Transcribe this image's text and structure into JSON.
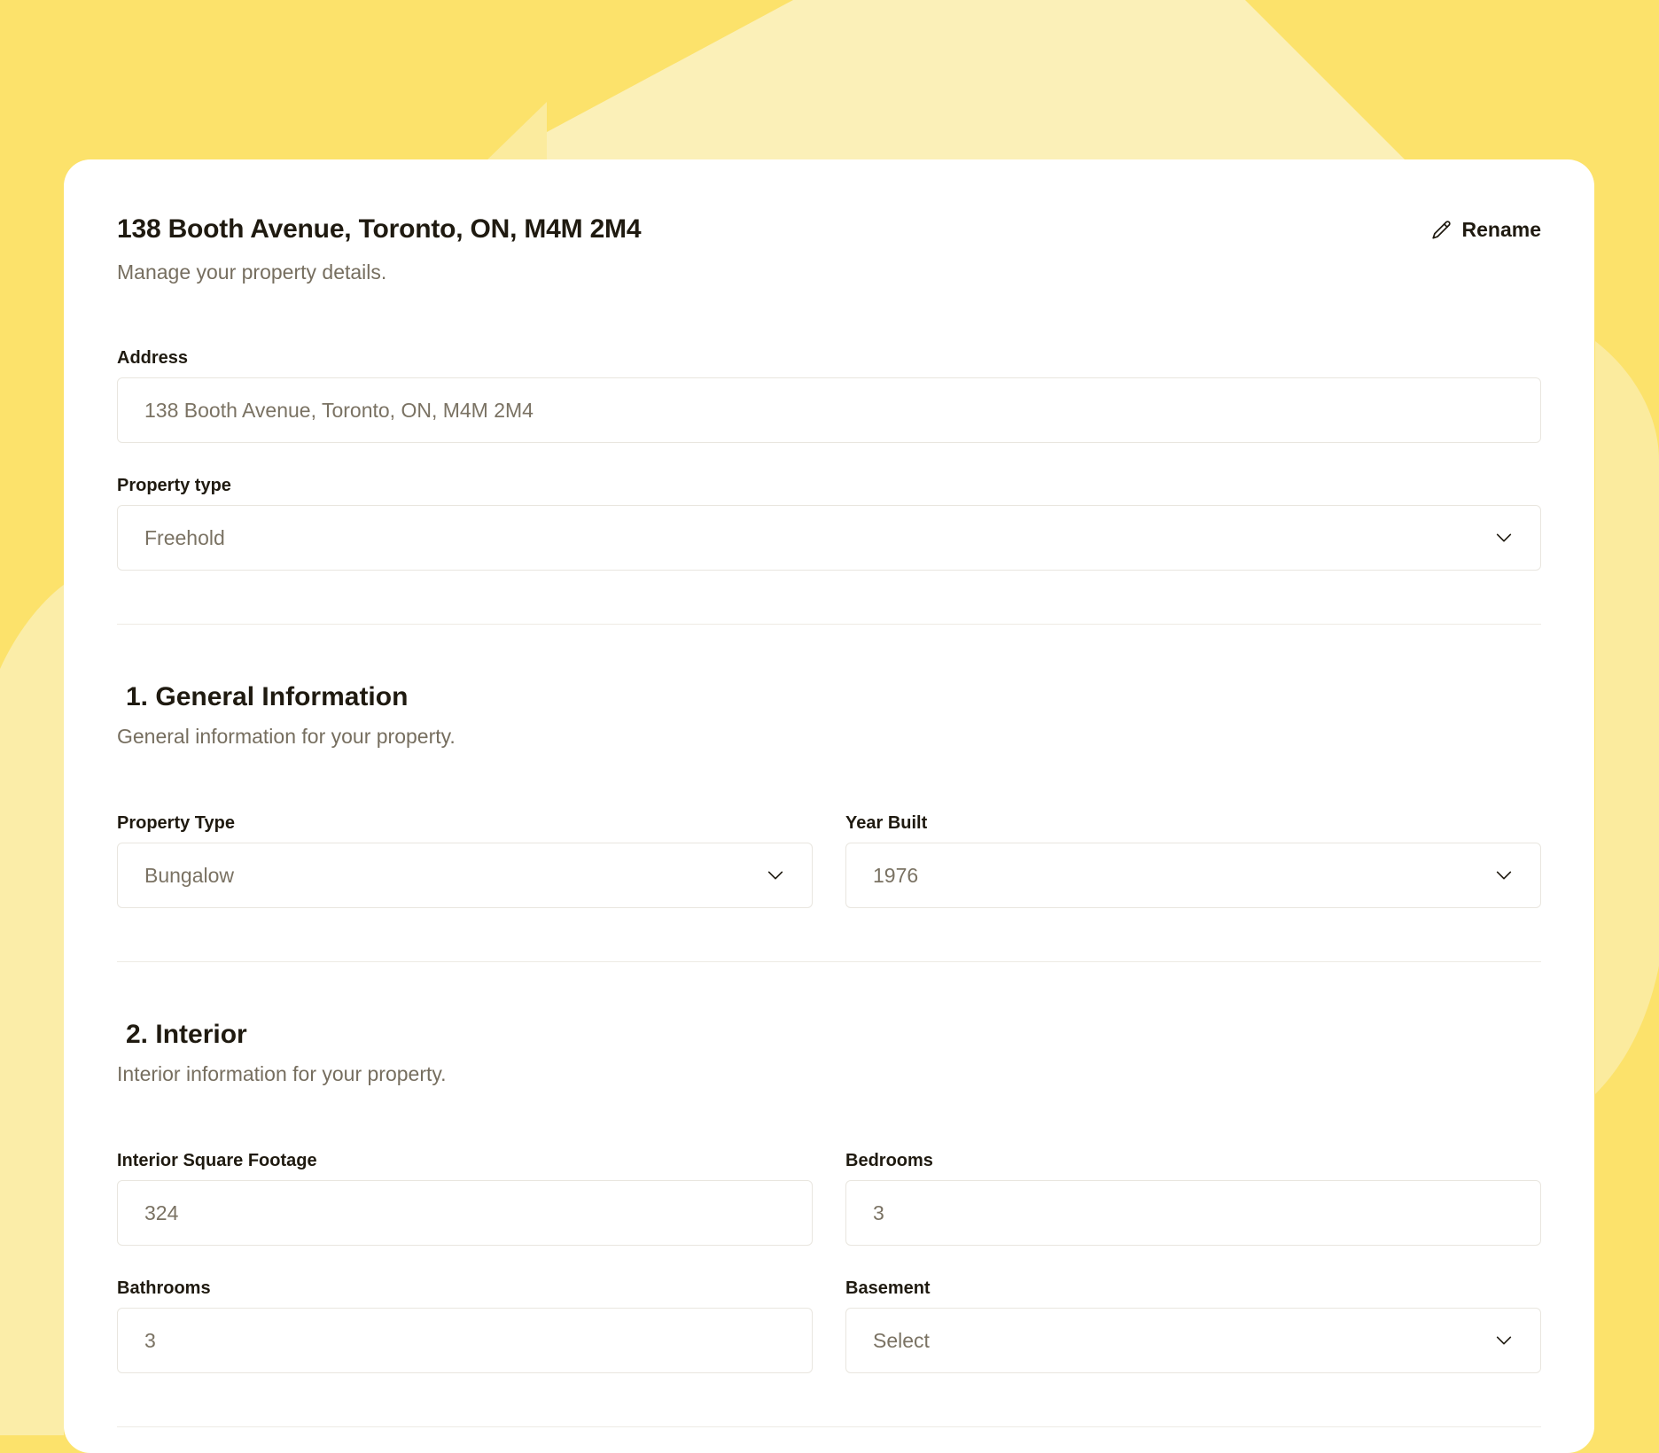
{
  "property": {
    "title": "138 Booth Avenue, Toronto, ON, M4M 2M4",
    "subtitle": "Manage your property details.",
    "rename_label": "Rename"
  },
  "fields": {
    "address": {
      "label": "Address",
      "value": "138 Booth Avenue, Toronto, ON, M4M 2M4"
    },
    "property_type": {
      "label": "Property type",
      "value": "Freehold"
    }
  },
  "sections": [
    {
      "number": "1.",
      "title": "General Information",
      "subtitle": "General information for your property.",
      "fields": [
        {
          "label": "Property Type",
          "value": "Bungalow"
        },
        {
          "label": "Year Built",
          "value": "1976"
        }
      ]
    },
    {
      "number": "2.",
      "title": "Interior",
      "subtitle": "Interior information for your property.",
      "fields": [
        {
          "label": "Interior Square Footage",
          "value": "324"
        },
        {
          "label": "Bedrooms",
          "value": "3"
        },
        {
          "label": "Bathrooms",
          "value": "3"
        },
        {
          "label": "Basement",
          "value": "Select"
        }
      ]
    }
  ],
  "colors": {
    "background": "#FCE26B",
    "background_light": "#FBF0B4",
    "text": "#1F1A10",
    "muted": "#766E5F",
    "border": "#E9E6DF"
  },
  "icons": {
    "rename": "pencil-icon",
    "dropdown": "chevron-down-icon"
  }
}
